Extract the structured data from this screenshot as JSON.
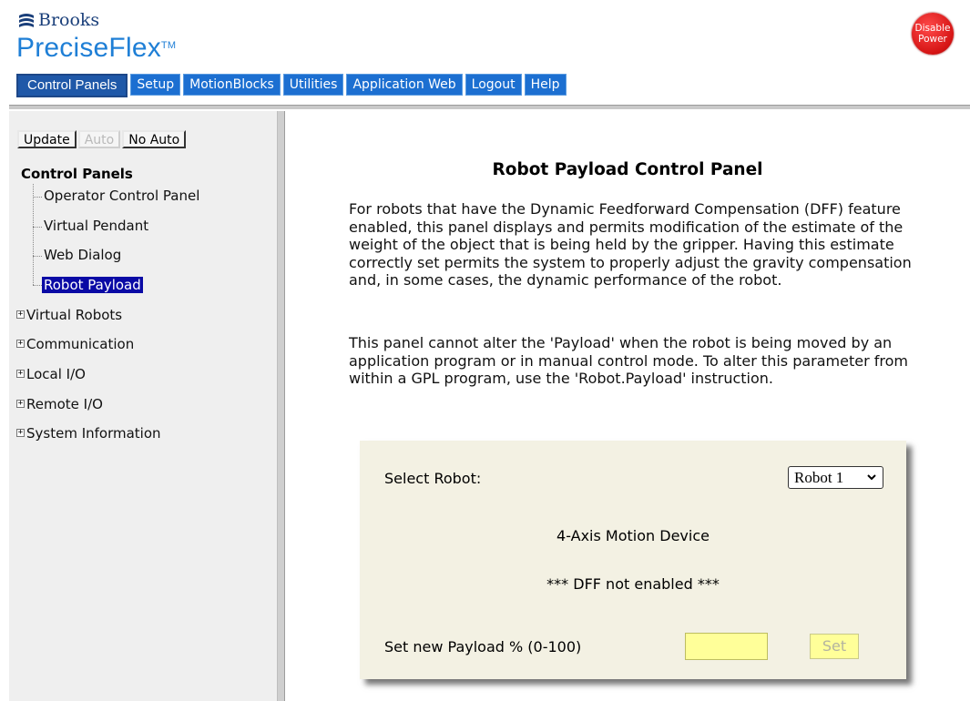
{
  "brand": {
    "company": "Brooks",
    "product": "PreciseFlex",
    "trademark": "TM",
    "disable_power": [
      "Disable",
      "Power"
    ]
  },
  "nav": {
    "tabs": [
      {
        "label": "Control Panels",
        "active": true
      },
      {
        "label": "Setup"
      },
      {
        "label": "MotionBlocks"
      },
      {
        "label": "Utilities"
      },
      {
        "label": "Application Web"
      },
      {
        "label": "Logout"
      },
      {
        "label": "Help"
      }
    ]
  },
  "sidebar": {
    "buttons": {
      "update": "Update",
      "auto": "Auto",
      "no_auto": "No Auto"
    },
    "title": "Control Panels",
    "items": [
      {
        "label": "Operator Control Panel"
      },
      {
        "label": "Virtual Pendant"
      },
      {
        "label": "Web Dialog"
      },
      {
        "label": "Robot Payload",
        "selected": true
      }
    ],
    "groups": [
      {
        "label": "Virtual Robots",
        "expand_symbol": "+"
      },
      {
        "label": "Communication",
        "expand_symbol": "+"
      },
      {
        "label": "Local I/O",
        "expand_symbol": "+"
      },
      {
        "label": "Remote I/O",
        "expand_symbol": "+"
      },
      {
        "label": "System Information",
        "expand_symbol": "+"
      }
    ]
  },
  "main": {
    "title": "Robot Payload Control Panel",
    "paragraph1": "For robots that have the Dynamic Feedforward Compensation (DFF) feature enabled, this panel displays and permits modification of the estimate of the weight of the object that is being held by the gripper. Having this estimate correctly set permits the system to properly adjust the gravity compensation and, in some cases, the dynamic performance of the robot.",
    "paragraph2": "This panel cannot alter the 'Payload' when the robot is being moved by an application program or in manual control mode. To alter this parameter from within a GPL program, use the 'Robot.Payload' instruction.",
    "panel": {
      "select_label": "Select Robot:",
      "select_value": "Robot 1",
      "device": "4-Axis Motion Device",
      "dff_status": "*** DFF not enabled ***",
      "payload_label": "Set new Payload % (0-100)",
      "payload_value": "",
      "set_label": "Set"
    }
  },
  "colors": {
    "nav_blue": "#1c6fd1",
    "selection": "#0a0aa5",
    "panel_bg": "#f3f1e3",
    "input_yellow": "#ffff99",
    "disable_red": "#d51414"
  }
}
